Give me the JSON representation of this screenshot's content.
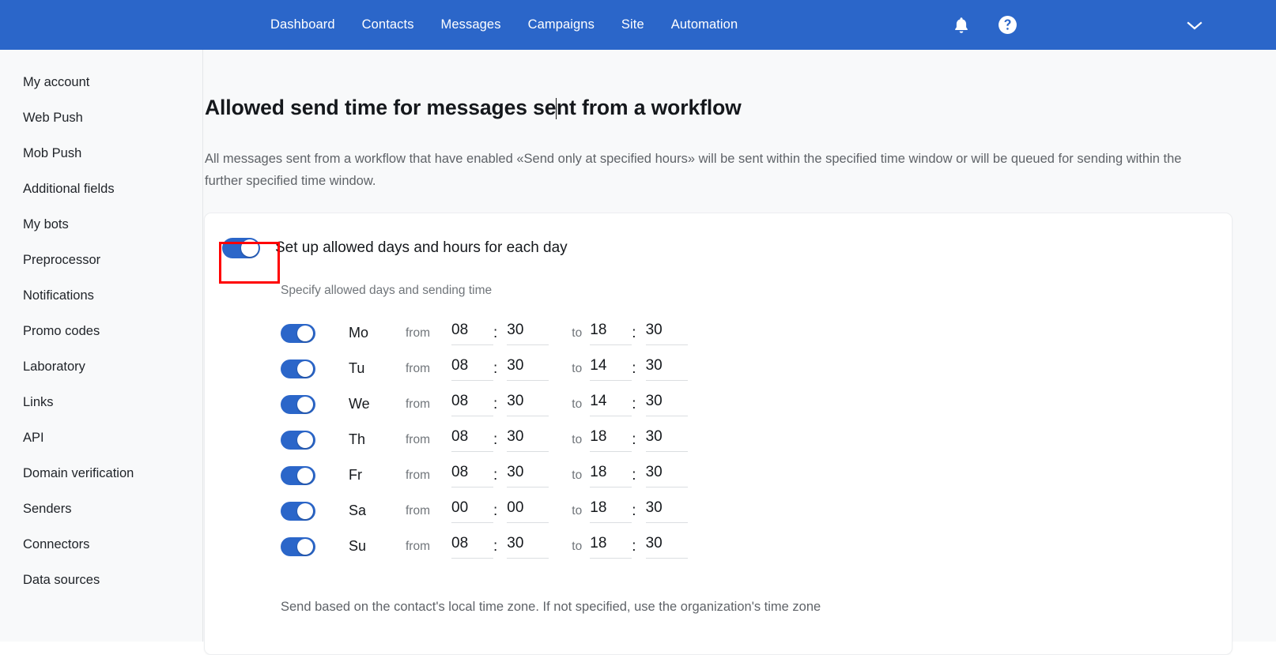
{
  "nav": {
    "links": [
      {
        "label": "Dashboard"
      },
      {
        "label": "Contacts"
      },
      {
        "label": "Messages"
      },
      {
        "label": "Campaigns"
      },
      {
        "label": "Site"
      },
      {
        "label": "Automation"
      }
    ],
    "icons": {
      "notifications": "bell-icon",
      "help": "question-mark-circle-icon",
      "account_menu": "chevron-down-icon"
    },
    "background_color": "#2b66c9"
  },
  "sidebar": {
    "items": [
      {
        "label": "My account"
      },
      {
        "label": "Web Push"
      },
      {
        "label": "Mob Push"
      },
      {
        "label": "Additional fields"
      },
      {
        "label": "My bots"
      },
      {
        "label": "Preprocessor"
      },
      {
        "label": "Notifications"
      },
      {
        "label": "Promo codes"
      },
      {
        "label": "Laboratory"
      },
      {
        "label": "Links"
      },
      {
        "label": "API"
      },
      {
        "label": "Domain verification"
      },
      {
        "label": "Senders"
      },
      {
        "label": "Connectors"
      },
      {
        "label": "Data sources"
      }
    ]
  },
  "main": {
    "title_before_caret": "Allowed send time for messages se",
    "title_after_caret": "nt from a workflow",
    "title_full": "Allowed send time for messages sent from a workflow",
    "description": "All messages sent from a workflow that have enabled «Send only at specified hours» will be sent within the specified time window or will be queued for sending within the further specified time window."
  },
  "card": {
    "master_toggle": {
      "label": "Set up allowed days and hours for each day",
      "sublabel": "Specify allowed days and sending time",
      "enabled": true,
      "highlight_color": "#ff0000"
    },
    "labels": {
      "from": "from",
      "to": "to",
      "colon": ":"
    },
    "days": [
      {
        "abbr": "Mo",
        "enabled": true,
        "from_hour": "08",
        "from_min": "30",
        "to_hour": "18",
        "to_min": "30"
      },
      {
        "abbr": "Tu",
        "enabled": true,
        "from_hour": "08",
        "from_min": "30",
        "to_hour": "14",
        "to_min": "30"
      },
      {
        "abbr": "We",
        "enabled": true,
        "from_hour": "08",
        "from_min": "30",
        "to_hour": "14",
        "to_min": "30"
      },
      {
        "abbr": "Th",
        "enabled": true,
        "from_hour": "08",
        "from_min": "30",
        "to_hour": "18",
        "to_min": "30"
      },
      {
        "abbr": "Fr",
        "enabled": true,
        "from_hour": "08",
        "from_min": "30",
        "to_hour": "18",
        "to_min": "30"
      },
      {
        "abbr": "Sa",
        "enabled": true,
        "from_hour": "00",
        "from_min": "00",
        "to_hour": "18",
        "to_min": "30"
      },
      {
        "abbr": "Su",
        "enabled": true,
        "from_hour": "08",
        "from_min": "30",
        "to_hour": "18",
        "to_min": "30"
      }
    ],
    "timezone_note": "Send based on the contact's local time zone. If not specified, use the organization's time zone"
  },
  "colors": {
    "accent": "#2b66c9",
    "page_background": "#f8f9fa",
    "card_background": "#ffffff",
    "annotation": "#ff0000"
  }
}
